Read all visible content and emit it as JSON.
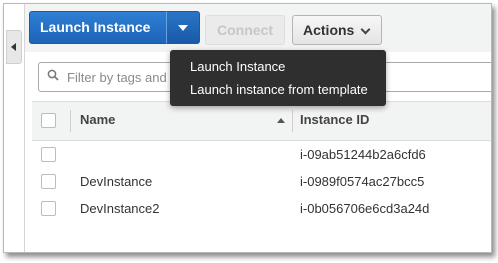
{
  "toolbar": {
    "launch_label": "Launch Instance",
    "connect_label": "Connect",
    "actions_label": "Actions"
  },
  "filter": {
    "placeholder": "Filter by tags and attributes or search by keyword"
  },
  "table": {
    "columns": [
      "Name",
      "Instance ID"
    ],
    "rows": [
      {
        "name": "",
        "instance_id": "i-09ab51244b2a6cfd6"
      },
      {
        "name": "DevInstance",
        "instance_id": "i-0989f0574ac27bcc5"
      },
      {
        "name": "DevInstance2",
        "instance_id": "i-0b056706e6cd3a24d"
      }
    ]
  },
  "launch_menu": {
    "items": [
      "Launch Instance",
      "Launch instance from template"
    ]
  },
  "icons": {
    "collapse": "chevron-left-icon",
    "launch_caret": "caret-down-icon",
    "actions_caret": "chevron-down-icon",
    "search": "search-icon",
    "sort": "sort-ascending-icon"
  },
  "colors": {
    "primary_button": "#1f6cc2",
    "menu_background": "#2f2f2f",
    "toolbar_background": "#f2f3f3"
  }
}
